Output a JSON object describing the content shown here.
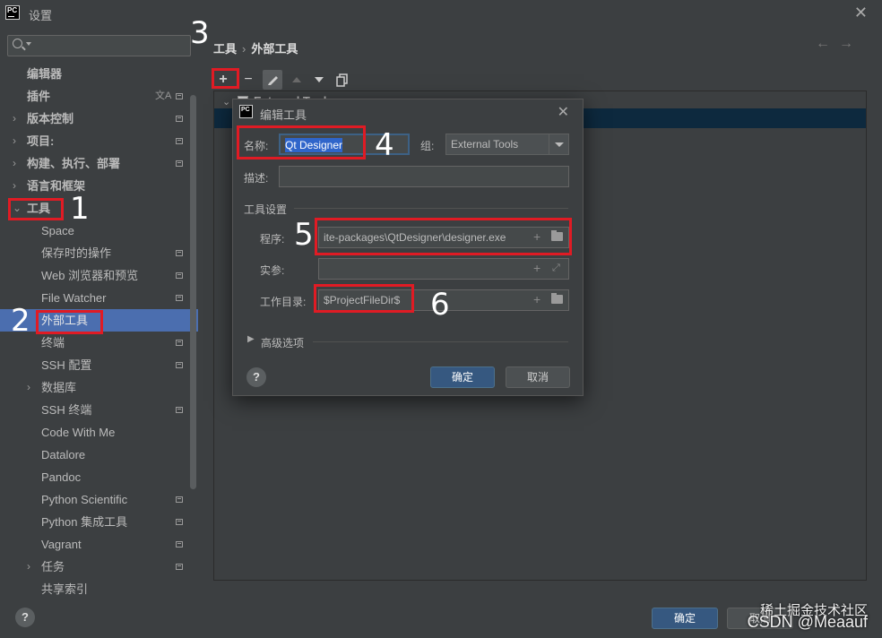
{
  "window": {
    "logo": "PC",
    "title": "设置",
    "close_icon": "✕"
  },
  "search": {
    "placeholder": "",
    "value": ""
  },
  "sidebar": {
    "items": [
      {
        "label": "编辑器",
        "level": 0,
        "expandable": false,
        "selected": false
      },
      {
        "label": "插件",
        "level": 0,
        "expandable": false,
        "selected": false
      },
      {
        "label": "版本控制",
        "level": 0,
        "expandable": true,
        "expanded": false,
        "selected": false
      },
      {
        "label": "项目: ",
        "level": 0,
        "expandable": true,
        "expanded": false,
        "selected": false
      },
      {
        "label": "构建、执行、部署",
        "level": 0,
        "expandable": true,
        "expanded": false,
        "selected": false
      },
      {
        "label": "语言和框架",
        "level": 0,
        "expandable": true,
        "expanded": false,
        "selected": false
      },
      {
        "label": "工具",
        "level": 0,
        "expandable": true,
        "expanded": true,
        "selected": false
      },
      {
        "label": "Space",
        "level": 1,
        "expandable": false,
        "selected": false
      },
      {
        "label": "保存时的操作",
        "level": 1,
        "expandable": false,
        "selected": false
      },
      {
        "label": "Web 浏览器和预览",
        "level": 1,
        "expandable": false,
        "selected": false
      },
      {
        "label": "File Watcher",
        "level": 1,
        "expandable": false,
        "selected": false
      },
      {
        "label": "外部工具",
        "level": 1,
        "expandable": false,
        "selected": true
      },
      {
        "label": "终端",
        "level": 1,
        "expandable": false,
        "selected": false
      },
      {
        "label": "SSH 配置",
        "level": 1,
        "expandable": false,
        "selected": false
      },
      {
        "label": "数据库",
        "level": 1,
        "expandable": true,
        "expanded": false,
        "selected": false
      },
      {
        "label": "SSH 终端",
        "level": 1,
        "expandable": false,
        "selected": false
      },
      {
        "label": "Code With Me",
        "level": 1,
        "expandable": false,
        "selected": false
      },
      {
        "label": "Datalore",
        "level": 1,
        "expandable": false,
        "selected": false
      },
      {
        "label": "Pandoc",
        "level": 1,
        "expandable": false,
        "selected": false
      },
      {
        "label": "Python Scientific",
        "level": 1,
        "expandable": false,
        "selected": false
      },
      {
        "label": "Python 集成工具",
        "level": 1,
        "expandable": false,
        "selected": false
      },
      {
        "label": "Vagrant",
        "level": 1,
        "expandable": false,
        "selected": false
      },
      {
        "label": "任务",
        "level": 1,
        "expandable": true,
        "expanded": false,
        "selected": false
      },
      {
        "label": "共享索引",
        "level": 1,
        "expandable": false,
        "selected": false
      }
    ]
  },
  "main": {
    "breadcrumb": [
      "工具",
      "外部工具"
    ],
    "tree_group": "External Tools"
  },
  "dialog": {
    "logo": "PC",
    "title": "编辑工具",
    "name_label": "名称:",
    "name_value": "Qt Designer",
    "group_label": "组:",
    "group_value": "External Tools",
    "description_label": "描述:",
    "description_value": "",
    "tool_settings_label": "工具设置",
    "program_label": "程序:",
    "program_value": "ite-packages\\QtDesigner\\designer.exe",
    "arguments_label": "实参:",
    "arguments_value": "",
    "working_dir_label": "工作目录:",
    "working_dir_value": "$ProjectFileDir$",
    "advanced_label": "高级选项",
    "ok_label": "确定",
    "cancel_label": "取消",
    "help_label": "?"
  },
  "footer": {
    "help_label": "?",
    "ok_label": "确定",
    "cancel_label": "取消"
  },
  "annotations": [
    "1",
    "2",
    "3",
    "4",
    "5",
    "6"
  ],
  "watermark": {
    "line1": "稀土掘金技术社区",
    "line2": "CSDN @Meaauf"
  },
  "colors": {
    "selection": "#4b6eaf",
    "annotation": "#e01b24",
    "primary_button": "#365880"
  }
}
